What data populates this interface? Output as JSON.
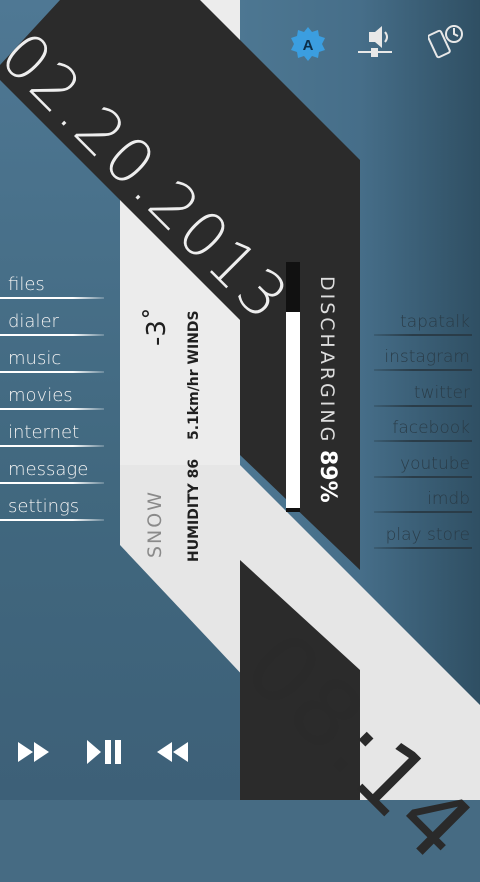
{
  "date": "02.20.2013",
  "time": "08:14",
  "weather": {
    "temperature": "-3˚",
    "condition": "SNOW",
    "humidity": "HUMIDITY 86",
    "wind": "5.1km/hr WINDS"
  },
  "battery": {
    "status": "DISCHARGING",
    "percent_label": "89%",
    "level": 0.89
  },
  "left_menu": [
    "files",
    "dialer",
    "music",
    "movies",
    "internet",
    "message",
    "settings"
  ],
  "right_menu": [
    "tapatalk",
    "instagram",
    "twitter",
    "facebook",
    "youtube",
    "imdb",
    "play store"
  ],
  "top_icons": [
    "auto-brightness-icon",
    "volume-settings-icon",
    "phone-rotate-icon"
  ],
  "top_icon_letter": "A",
  "media_controls": [
    "fast-forward-icon",
    "play-pause-icon",
    "rewind-icon"
  ],
  "colors": {
    "background": "#466b83",
    "dark_band": "#2b2b2b",
    "light_band": "#e9e9e9",
    "accent_blue": "#3b9ee0"
  }
}
